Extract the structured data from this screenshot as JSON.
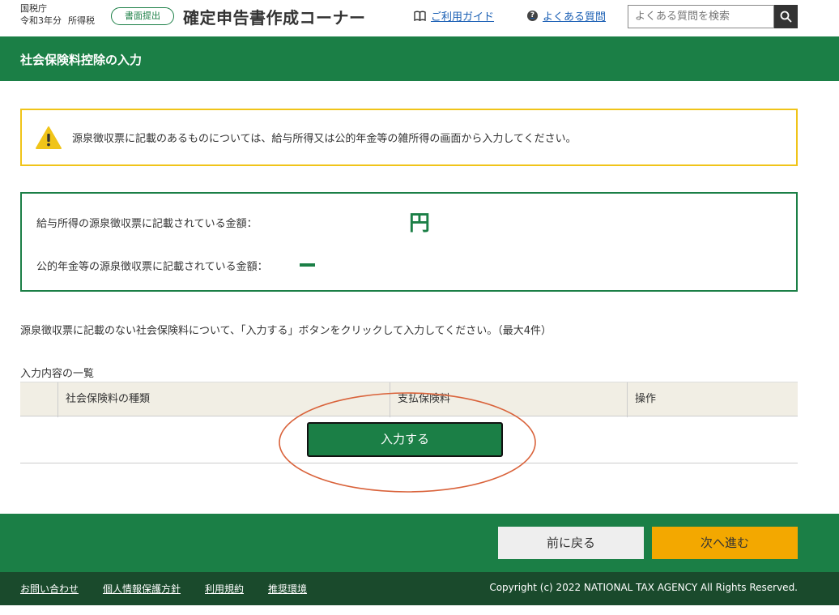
{
  "header": {
    "agency": "国税庁",
    "year": "令和3年分",
    "tax_type": "所得税",
    "badge": "書面提出",
    "site_title": "確定申告書作成コーナー",
    "guide_link": "ご利用ガイド",
    "faq_link": "よくある質問",
    "search_placeholder": "よくある質問を検索",
    "icons": [
      "book-icon",
      "question-icon",
      "search-icon"
    ]
  },
  "page": {
    "title": "社会保険料控除の入力"
  },
  "warning": {
    "text": "源泉徴収票に記載のあるものについては、給与所得又は公的年金等の雑所得の画面から入力してください。",
    "icon": "warning-icon",
    "border_color": "#f0c419"
  },
  "info": {
    "salary_label": "給与所得の源泉徴収票に記載されている金額：",
    "salary_value": "円",
    "pension_label": "公的年金等の源泉徴収票に記載されている金額：",
    "pension_value": "ー"
  },
  "instruction": "源泉徴収票に記載のない社会保険料について、「入力する」ボタンをクリックして入力してください。（最大4件）",
  "list": {
    "caption": "入力内容の一覧",
    "columns": [
      "",
      "社会保険料の種類",
      "支払保険料",
      "操作"
    ],
    "rows": [],
    "input_button": "入力する"
  },
  "nav": {
    "back": "前に戻る",
    "next": "次へ進む"
  },
  "footer": {
    "links": [
      "お問い合わせ",
      "個人情報保護方針",
      "利用規約",
      "推奨環境"
    ],
    "copyright": "Copyright (c) 2022 NATIONAL TAX AGENCY All Rights Reserved."
  },
  "colors": {
    "brand_green": "#1b7f46",
    "dark_green": "#1a4a2c",
    "next_button": "#f3a800",
    "annotation": "#d9623a"
  }
}
